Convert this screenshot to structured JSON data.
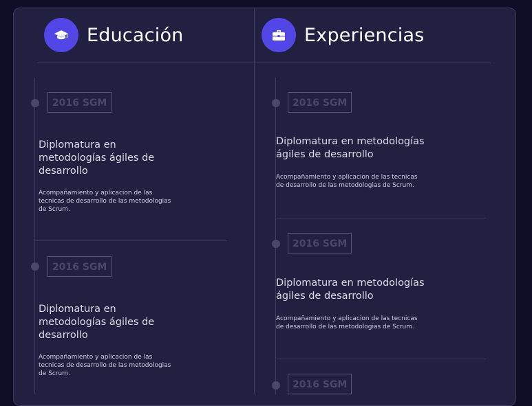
{
  "education": {
    "title": "Educación",
    "icon": "graduation-cap-icon",
    "items": [
      {
        "date": "2016 SGM",
        "title": "Diplomatura en metodologías ágiles de desarrollo",
        "description": "Acompañamiento y aplicacion de las tecnicas de desarrollo de las metodologias de Scrum."
      },
      {
        "date": "2016 SGM",
        "title": "Diplomatura en metodologías ágiles de desarrollo",
        "description": "Acompañamiento y aplicacion de las tecnicas de desarrollo de las metodologias de Scrum."
      }
    ]
  },
  "experience": {
    "title": "Experiencias",
    "icon": "briefcase-icon",
    "items": [
      {
        "date": "2016 SGM",
        "title": "Diplomatura en metodologías ágiles de desarrollo",
        "description": "Acompañamiento y aplicacion de las tecnicas de desarrollo de las metodologias de Scrum."
      },
      {
        "date": "2016 SGM",
        "title": "Diplomatura en metodologías ágiles de desarrollo",
        "description": "Acompañamiento y aplicacion de las tecnicas de desarrollo de las metodologias de Scrum."
      },
      {
        "date": "2016 SGM"
      }
    ]
  },
  "colors": {
    "page_background": "#0e0d26",
    "card_background": "#222041",
    "accent": "#5247e6",
    "border": "#3d3b5f"
  }
}
